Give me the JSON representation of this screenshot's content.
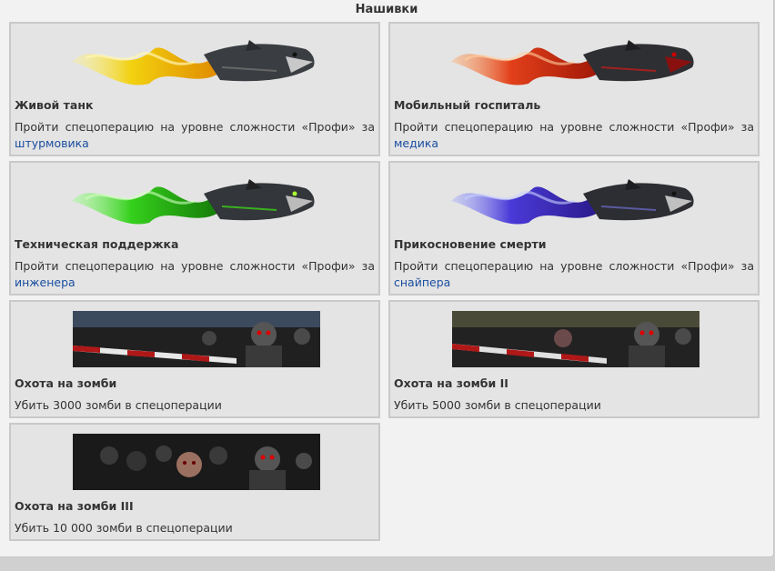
{
  "header": {
    "title": "Нашивки"
  },
  "colors": {
    "yellow_flame": "#f2d10f",
    "red_flame": "#e2401a",
    "green_flame": "#35d01c",
    "blue_flame": "#4a3ad8",
    "link": "#1a4ea0"
  },
  "cards": [
    {
      "title": "Живой танк",
      "desc_prefix": "Пройти спецоперацию на уровне сложности «Профи» за",
      "link": "штурмовика",
      "icon": "shark-yellow-flame-icon"
    },
    {
      "title": "Мобильный госпиталь",
      "desc_prefix": "Пройти спецоперацию на уровне сложности «Профи» за",
      "link": "медика",
      "icon": "shark-red-flame-icon"
    },
    {
      "title": "Техническая поддержка",
      "desc_prefix": "Пройти спецоперацию на уровне сложности «Профи» за",
      "link": "инженера",
      "icon": "shark-green-flame-icon"
    },
    {
      "title": "Прикосновение смерти",
      "desc_prefix": "Пройти спецоперацию на уровне сложности «Профи» за",
      "link": "снайпера",
      "icon": "shark-blue-flame-icon"
    },
    {
      "title": "Охота на зомби",
      "desc": "Убить 3000 зомби в спецоперации",
      "icon": "zombie-hunt-icon"
    },
    {
      "title": "Охота на зомби II",
      "desc": "Убить 5000 зомби в спецоперации",
      "icon": "zombie-hunt-2-icon"
    },
    {
      "title": "Охота на зомби III",
      "desc": "Убить 10 000 зомби в спецоперации",
      "icon": "zombie-hunt-3-icon"
    }
  ]
}
